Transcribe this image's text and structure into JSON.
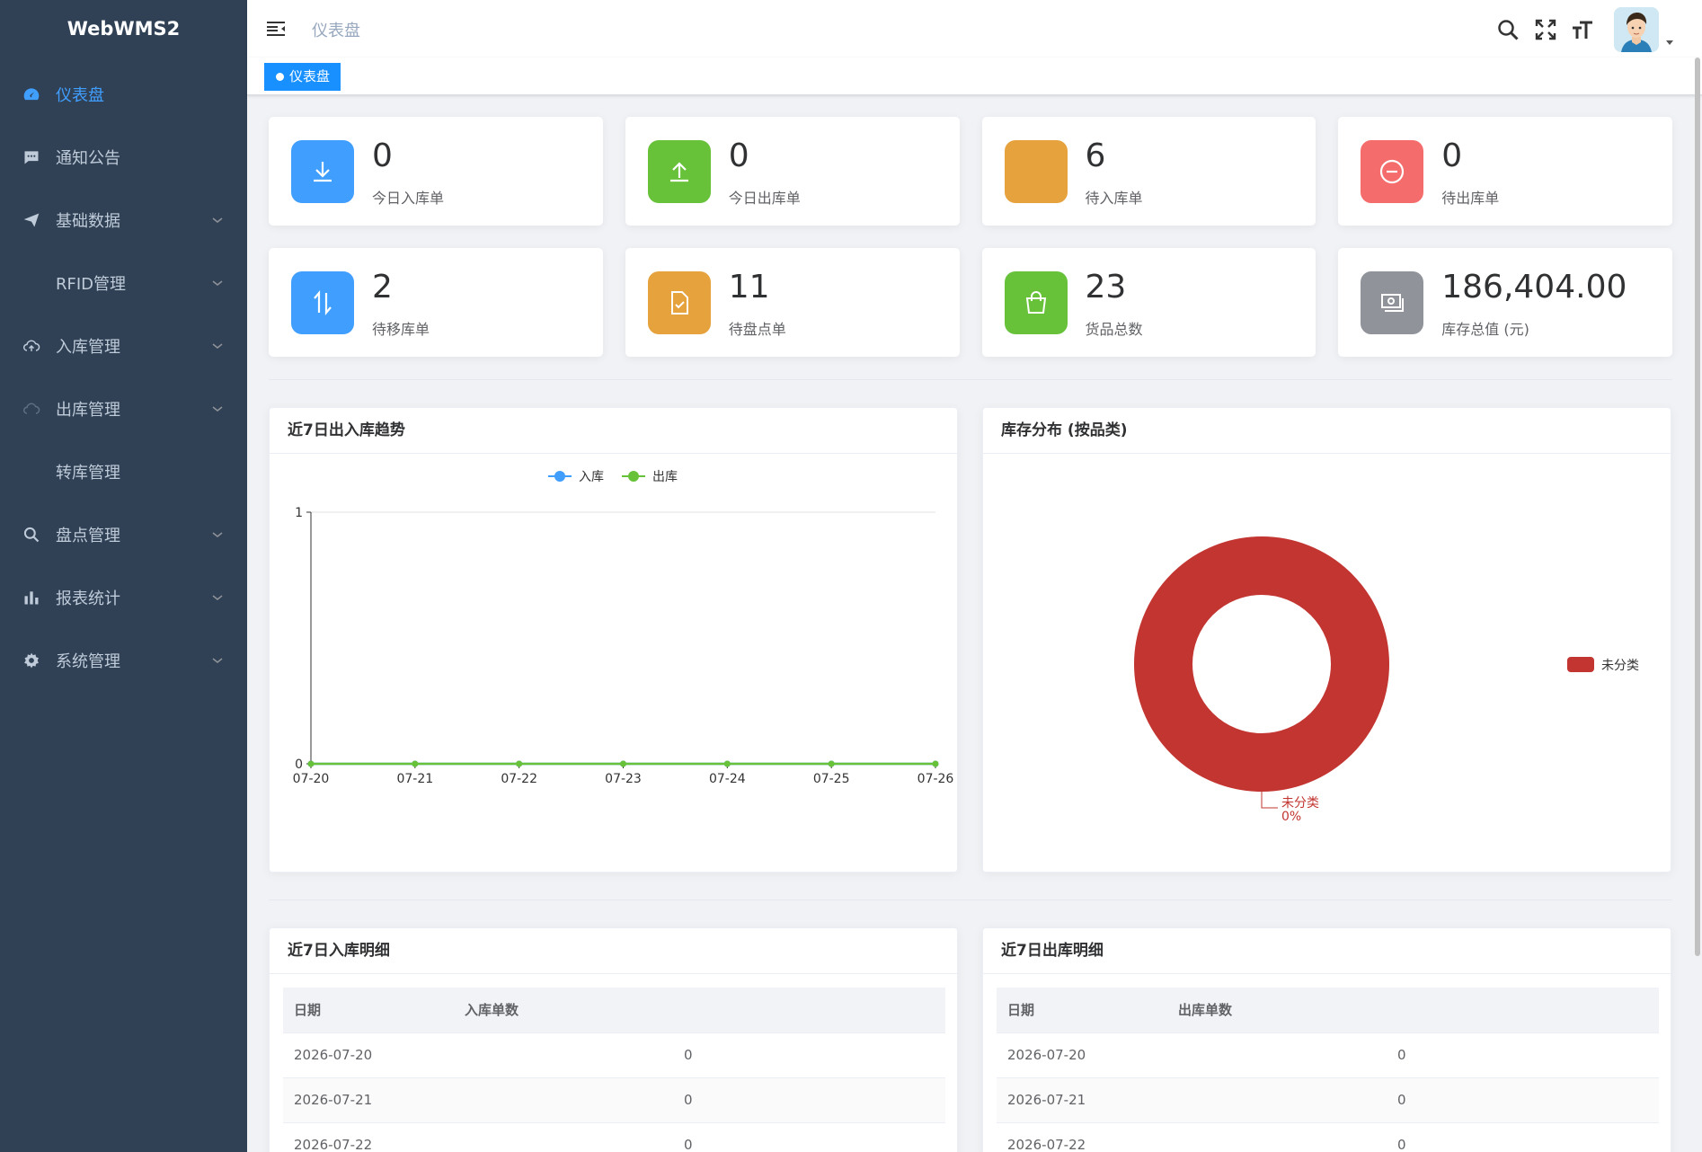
{
  "app": {
    "title": "WebWMS2"
  },
  "sidebar": {
    "items": [
      {
        "label": "仪表盘",
        "icon": "dashboard-icon",
        "active": true,
        "has_children": false
      },
      {
        "label": "通知公告",
        "icon": "message-icon",
        "active": false,
        "has_children": false
      },
      {
        "label": "基础数据",
        "icon": "send-icon",
        "active": false,
        "has_children": true
      },
      {
        "label": "RFID管理",
        "icon": "",
        "active": false,
        "has_children": true
      },
      {
        "label": "入库管理",
        "icon": "upload-cloud-icon",
        "active": false,
        "has_children": true
      },
      {
        "label": "出库管理",
        "icon": "download-cloud-icon",
        "active": false,
        "has_children": true
      },
      {
        "label": "转库管理",
        "icon": "",
        "active": false,
        "has_children": false
      },
      {
        "label": "盘点管理",
        "icon": "search-icon",
        "active": false,
        "has_children": true
      },
      {
        "label": "报表统计",
        "icon": "bar-chart-icon",
        "active": false,
        "has_children": true
      },
      {
        "label": "系统管理",
        "icon": "gear-icon",
        "active": false,
        "has_children": true
      }
    ]
  },
  "navbar": {
    "breadcrumb": "仪表盘"
  },
  "tags": {
    "active": "仪表盘"
  },
  "stats": [
    {
      "value": "0",
      "label": "今日入库单",
      "color": "#409eff",
      "icon": "download-icon"
    },
    {
      "value": "0",
      "label": "今日出库单",
      "color": "#67c23a",
      "icon": "upload-icon"
    },
    {
      "value": "6",
      "label": "待入库单",
      "color": "#e6a23c",
      "icon": "blank-icon"
    },
    {
      "value": "0",
      "label": "待出库单",
      "color": "#f56c6c",
      "icon": "minus-circle-icon"
    },
    {
      "value": "2",
      "label": "待移库单",
      "color": "#409eff",
      "icon": "transfer-icon"
    },
    {
      "value": "11",
      "label": "待盘点单",
      "color": "#e6a23c",
      "icon": "document-check-icon"
    },
    {
      "value": "23",
      "label": "货品总数",
      "color": "#67c23a",
      "icon": "shopping-bag-icon"
    },
    {
      "value": "186,404.00",
      "label": "库存总值 (元)",
      "color": "#909399",
      "icon": "money-icon"
    }
  ],
  "trend_panel": {
    "title": "近7日出入库趋势"
  },
  "pie_panel": {
    "title": "库存分布 (按品类)"
  },
  "chart_data": [
    {
      "type": "line",
      "title": "近7日出入库趋势",
      "x": [
        "07-20",
        "07-21",
        "07-22",
        "07-23",
        "07-24",
        "07-25",
        "07-26"
      ],
      "ylim": [
        0,
        1
      ],
      "yticks": [
        "0",
        "1"
      ],
      "legend": "top-center",
      "series": [
        {
          "name": "入库",
          "color": "#409eff",
          "values": [
            0,
            0,
            0,
            0,
            0,
            0,
            0
          ]
        },
        {
          "name": "出库",
          "color": "#67c23a",
          "values": [
            0,
            0,
            0,
            0,
            0,
            0,
            0
          ]
        }
      ]
    },
    {
      "type": "pie",
      "title": "库存分布 (按品类)",
      "legend": "right",
      "slices": [
        {
          "name": "未分类",
          "value": 1,
          "percent": "0%",
          "color": "#c23531"
        }
      ]
    }
  ],
  "inbound_table": {
    "title": "近7日入库明细",
    "columns": [
      "日期",
      "入库单数"
    ],
    "rows": [
      [
        "2026-07-20",
        "0"
      ],
      [
        "2026-07-21",
        "0"
      ],
      [
        "2026-07-22",
        "0"
      ]
    ]
  },
  "outbound_table": {
    "title": "近7日出库明细",
    "columns": [
      "日期",
      "出库单数"
    ],
    "rows": [
      [
        "2026-07-20",
        "0"
      ],
      [
        "2026-07-21",
        "0"
      ],
      [
        "2026-07-22",
        "0"
      ]
    ]
  }
}
